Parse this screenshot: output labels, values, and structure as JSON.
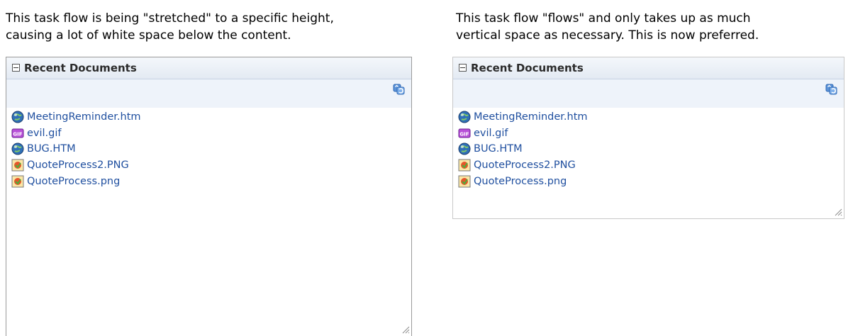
{
  "left": {
    "caption_line1": "This task flow is being \"stretched\" to a specific height,",
    "caption_line2": "causing a lot of white space below the content.",
    "panel_title": "Recent Documents"
  },
  "right": {
    "caption_line1": "This task flow \"flows\" and only takes up as much",
    "caption_line2": "vertical space as necessary.  This is now preferred.",
    "panel_title": "Recent Documents"
  },
  "documents": [
    {
      "name": "MeetingReminder.htm",
      "icon": "globe-icon"
    },
    {
      "name": "evil.gif",
      "icon": "gif-icon"
    },
    {
      "name": "BUG.HTM",
      "icon": "globe-icon"
    },
    {
      "name": "QuoteProcess2.PNG",
      "icon": "image-icon"
    },
    {
      "name": "QuoteProcess.png",
      "icon": "image-icon"
    }
  ],
  "colors": {
    "link": "#1f4f9f",
    "header_bg": "#e3eaf3",
    "toolbar_bg": "#eef3fa",
    "refresh_icon": "#3a78c8"
  }
}
